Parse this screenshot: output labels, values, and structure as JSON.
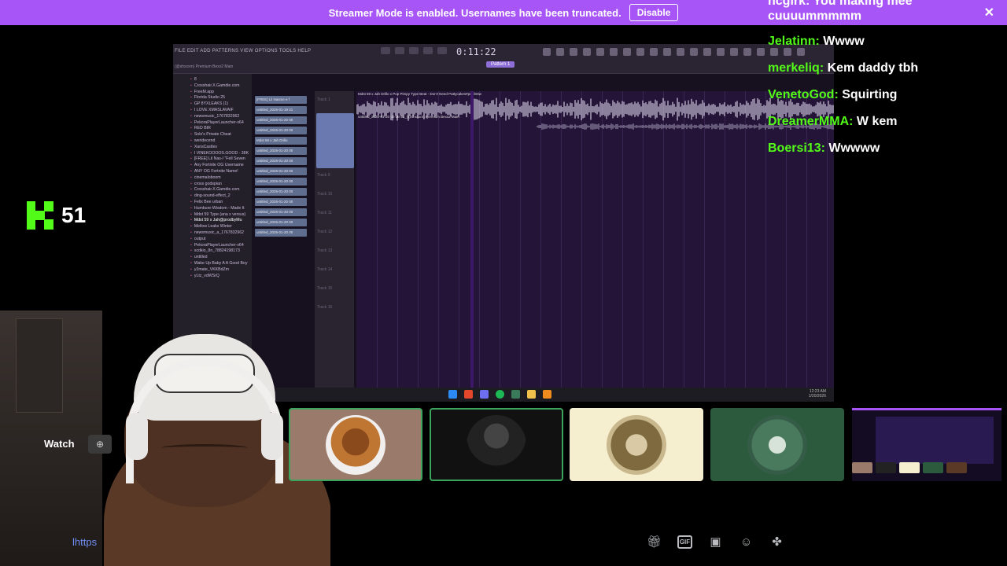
{
  "banner": {
    "text": "Streamer Mode is enabled. Usernames have been truncated.",
    "button": "Disable",
    "close_icon": "close-icon"
  },
  "chat": {
    "first_line": "ncgirk: You making mee",
    "first_continuation": "cuuuummmmm",
    "messages": [
      {
        "user": "Jelatinn:",
        "text": "Wwww"
      },
      {
        "user": "merkeliq:",
        "text": "Kem daddy tbh"
      },
      {
        "user": "VenetoGod:",
        "text": "Squirting"
      },
      {
        "user": "DreamerMMA:",
        "text": "W kem"
      },
      {
        "user": "Boersi13:",
        "text": "Wwwww"
      }
    ]
  },
  "viewers": {
    "count": "51",
    "icon": "kick-logo-icon",
    "accent": "#53fc18"
  },
  "fl": {
    "menu": "FILE  EDIT  ADD  PATTERNS  VIEW  OPTIONS  TOOLS  HELP",
    "title": "(@shxxxm) Premium Bexx2 Main",
    "time": "0:11:22",
    "pattern": "Pattern 1",
    "audio_label": "Mdst 59 x Jah Drillo x Pop Pimpy Type Beat - Don't Need Pattycakes#prodmtw",
    "audio_label2": "untitled_2026-01-20 00-16-31_(@shxxxm) Premium Bexx2 Main",
    "browser": [
      "8",
      "Crosshair.X.Gamdie.com",
      "FreeM.app",
      "Florida Studio 25",
      "GP 8YXLEAKS (1)",
      "I LOVE XMASLAVAIF",
      "newsmusic_1767832962",
      "PekoraPlayerLauncher-x64",
      "RED BIR",
      "Solo's Private Cheat",
      "weridecend",
      "XansCastles",
      "I VINEKOOOOS.GOOD - 38K",
      "[FREE] Lil Nas-/ \"Fell Seven",
      "Any Fortnite OG Username",
      "ANY OG Fortnite Name!",
      "cinemaloboom",
      "cross godspian",
      "Crosshair.X.Gamdie.com",
      "ding-sound-effect_2",
      "Felix Bee urban",
      "Humbure-Wisdom - Made It",
      "Mdst 59 Type (ana x versus)",
      "Mdst 59 x Jah@prodbyMu",
      "Mellow Leaks Winter",
      "newsmusic_a_1767832962",
      "output",
      "PekoraPlayerLauncher-x64",
      "scdkio_8n_78824198173",
      "untitled",
      "Wake Up Baby A A Good Boy",
      "y2mate_VKKBdZm",
      "yLtz_vdWSrQ"
    ],
    "channels": [
      "[FREE] Lil Nasme e f",
      "untitled_2026-01-19 21",
      "untitled_2026-01-20 00",
      "untitled_2026-01-20 00",
      "Mdst 59 x Jah Drillo",
      "untitled_2026-01-20 00",
      "untitled_2026-01-20 00",
      "untitled_2026-01-20 00",
      "untitled_2026-01-20 00",
      "untitled_2026-01-20 00",
      "untitled_2026-01-20 00",
      "untitled_2026-01-20 00",
      "untitled_2026-01-20 00",
      "untitled_2026-01-20 00"
    ],
    "tracks": [
      "Track 1",
      "Insert 8",
      "Track 7",
      "Track 8",
      "Track 9",
      "Track 10",
      "Track 11",
      "Track 12",
      "Track 13",
      "Track 14",
      "Track 15",
      "Track 16"
    ],
    "clock_time": "12:23 AM",
    "clock_date": "1/20/2026"
  },
  "cam": {
    "watch_label": "Watch",
    "link_text": "lhttps"
  },
  "tiles": [
    {
      "name": "participant-1",
      "accent": "#3ba55d"
    },
    {
      "name": "participant-2",
      "accent": "#3ba55d"
    },
    {
      "name": "participant-3"
    },
    {
      "name": "participant-4"
    }
  ],
  "bottom_icons": [
    "gift-icon",
    "gif-icon",
    "sticker-icon",
    "emoji-icon",
    "apps-icon"
  ],
  "colors": {
    "banner": "#a855f7",
    "kick_green": "#53fc18",
    "link": "#6f8ff2"
  }
}
